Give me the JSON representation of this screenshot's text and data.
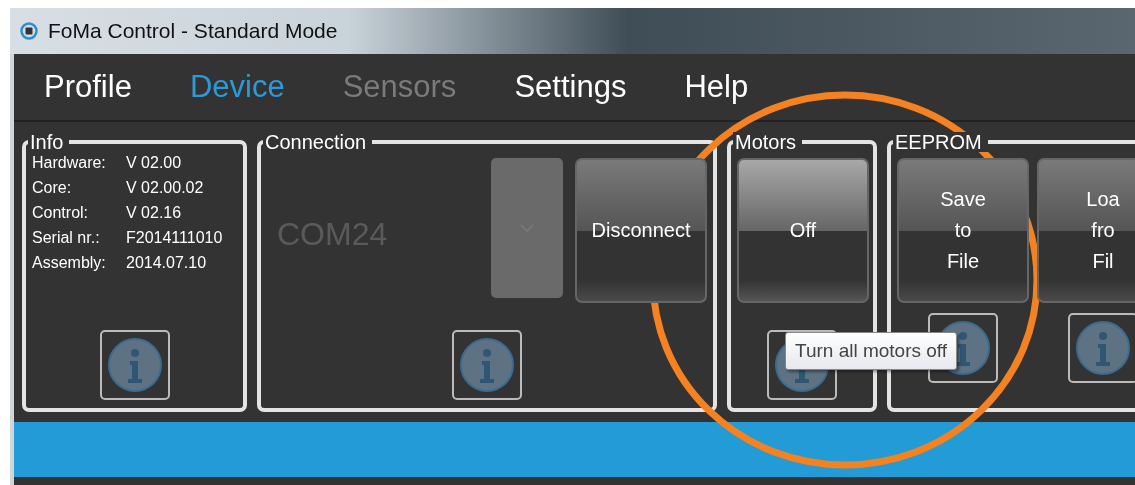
{
  "window": {
    "title": "FoMa Control - Standard Mode"
  },
  "menu": [
    {
      "label": "Profile",
      "selected": false,
      "disabled": false
    },
    {
      "label": "Device",
      "selected": true,
      "disabled": false
    },
    {
      "label": "Sensors",
      "selected": false,
      "disabled": true
    },
    {
      "label": "Settings",
      "selected": false,
      "disabled": false
    },
    {
      "label": "Help",
      "selected": false,
      "disabled": false
    }
  ],
  "info": {
    "title": "Info",
    "rows": [
      {
        "label": "Hardware:",
        "value": "V 02.00"
      },
      {
        "label": "Core:",
        "value": "V 02.00.02"
      },
      {
        "label": "Control:",
        "value": "V 02.16"
      },
      {
        "label": "Serial nr.:",
        "value": "F2014111010"
      },
      {
        "label": "Assembly:",
        "value": "2014.07.10"
      }
    ]
  },
  "connection": {
    "title": "Connection",
    "port": "COM24",
    "button": "Disconnect"
  },
  "motors": {
    "title": "Motors",
    "button": "Off"
  },
  "eeprom": {
    "title": "EEPROM",
    "buttons": [
      {
        "lines": [
          "Save",
          "to",
          "File"
        ]
      },
      {
        "lines": [
          "Loa",
          "fro",
          "Fil"
        ]
      }
    ]
  },
  "tooltip": {
    "text": "Turn all motors off"
  }
}
